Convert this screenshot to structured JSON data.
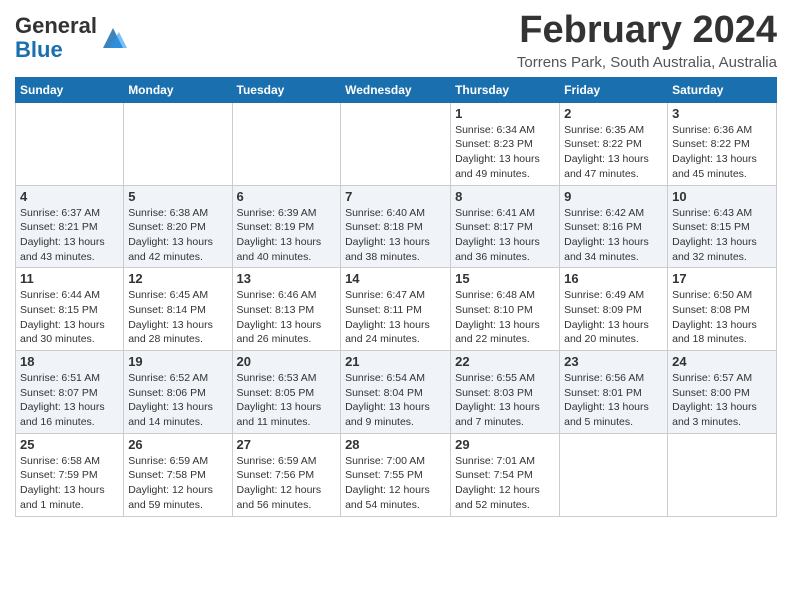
{
  "header": {
    "logo_general": "General",
    "logo_blue": "Blue",
    "month_title": "February 2024",
    "location": "Torrens Park, South Australia, Australia"
  },
  "weekdays": [
    "Sunday",
    "Monday",
    "Tuesday",
    "Wednesday",
    "Thursday",
    "Friday",
    "Saturday"
  ],
  "weeks": [
    [
      {
        "day": "",
        "info": ""
      },
      {
        "day": "",
        "info": ""
      },
      {
        "day": "",
        "info": ""
      },
      {
        "day": "",
        "info": ""
      },
      {
        "day": "1",
        "info": "Sunrise: 6:34 AM\nSunset: 8:23 PM\nDaylight: 13 hours and 49 minutes."
      },
      {
        "day": "2",
        "info": "Sunrise: 6:35 AM\nSunset: 8:22 PM\nDaylight: 13 hours and 47 minutes."
      },
      {
        "day": "3",
        "info": "Sunrise: 6:36 AM\nSunset: 8:22 PM\nDaylight: 13 hours and 45 minutes."
      }
    ],
    [
      {
        "day": "4",
        "info": "Sunrise: 6:37 AM\nSunset: 8:21 PM\nDaylight: 13 hours and 43 minutes."
      },
      {
        "day": "5",
        "info": "Sunrise: 6:38 AM\nSunset: 8:20 PM\nDaylight: 13 hours and 42 minutes."
      },
      {
        "day": "6",
        "info": "Sunrise: 6:39 AM\nSunset: 8:19 PM\nDaylight: 13 hours and 40 minutes."
      },
      {
        "day": "7",
        "info": "Sunrise: 6:40 AM\nSunset: 8:18 PM\nDaylight: 13 hours and 38 minutes."
      },
      {
        "day": "8",
        "info": "Sunrise: 6:41 AM\nSunset: 8:17 PM\nDaylight: 13 hours and 36 minutes."
      },
      {
        "day": "9",
        "info": "Sunrise: 6:42 AM\nSunset: 8:16 PM\nDaylight: 13 hours and 34 minutes."
      },
      {
        "day": "10",
        "info": "Sunrise: 6:43 AM\nSunset: 8:15 PM\nDaylight: 13 hours and 32 minutes."
      }
    ],
    [
      {
        "day": "11",
        "info": "Sunrise: 6:44 AM\nSunset: 8:15 PM\nDaylight: 13 hours and 30 minutes."
      },
      {
        "day": "12",
        "info": "Sunrise: 6:45 AM\nSunset: 8:14 PM\nDaylight: 13 hours and 28 minutes."
      },
      {
        "day": "13",
        "info": "Sunrise: 6:46 AM\nSunset: 8:13 PM\nDaylight: 13 hours and 26 minutes."
      },
      {
        "day": "14",
        "info": "Sunrise: 6:47 AM\nSunset: 8:11 PM\nDaylight: 13 hours and 24 minutes."
      },
      {
        "day": "15",
        "info": "Sunrise: 6:48 AM\nSunset: 8:10 PM\nDaylight: 13 hours and 22 minutes."
      },
      {
        "day": "16",
        "info": "Sunrise: 6:49 AM\nSunset: 8:09 PM\nDaylight: 13 hours and 20 minutes."
      },
      {
        "day": "17",
        "info": "Sunrise: 6:50 AM\nSunset: 8:08 PM\nDaylight: 13 hours and 18 minutes."
      }
    ],
    [
      {
        "day": "18",
        "info": "Sunrise: 6:51 AM\nSunset: 8:07 PM\nDaylight: 13 hours and 16 minutes."
      },
      {
        "day": "19",
        "info": "Sunrise: 6:52 AM\nSunset: 8:06 PM\nDaylight: 13 hours and 14 minutes."
      },
      {
        "day": "20",
        "info": "Sunrise: 6:53 AM\nSunset: 8:05 PM\nDaylight: 13 hours and 11 minutes."
      },
      {
        "day": "21",
        "info": "Sunrise: 6:54 AM\nSunset: 8:04 PM\nDaylight: 13 hours and 9 minutes."
      },
      {
        "day": "22",
        "info": "Sunrise: 6:55 AM\nSunset: 8:03 PM\nDaylight: 13 hours and 7 minutes."
      },
      {
        "day": "23",
        "info": "Sunrise: 6:56 AM\nSunset: 8:01 PM\nDaylight: 13 hours and 5 minutes."
      },
      {
        "day": "24",
        "info": "Sunrise: 6:57 AM\nSunset: 8:00 PM\nDaylight: 13 hours and 3 minutes."
      }
    ],
    [
      {
        "day": "25",
        "info": "Sunrise: 6:58 AM\nSunset: 7:59 PM\nDaylight: 13 hours and 1 minute."
      },
      {
        "day": "26",
        "info": "Sunrise: 6:59 AM\nSunset: 7:58 PM\nDaylight: 12 hours and 59 minutes."
      },
      {
        "day": "27",
        "info": "Sunrise: 6:59 AM\nSunset: 7:56 PM\nDaylight: 12 hours and 56 minutes."
      },
      {
        "day": "28",
        "info": "Sunrise: 7:00 AM\nSunset: 7:55 PM\nDaylight: 12 hours and 54 minutes."
      },
      {
        "day": "29",
        "info": "Sunrise: 7:01 AM\nSunset: 7:54 PM\nDaylight: 12 hours and 52 minutes."
      },
      {
        "day": "",
        "info": ""
      },
      {
        "day": "",
        "info": ""
      }
    ]
  ]
}
